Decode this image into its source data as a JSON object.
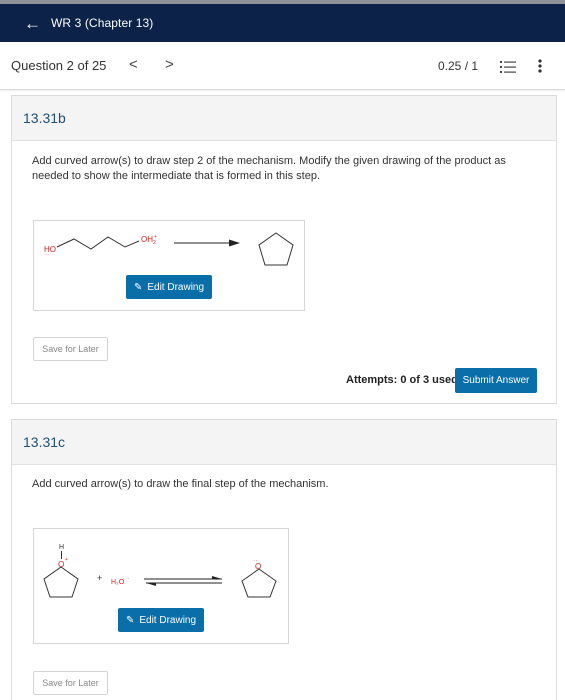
{
  "header": {
    "title": "WR 3 (Chapter 13)",
    "back_icon": "arrow-left-icon"
  },
  "question_bar": {
    "count": "Question 2 of 25",
    "prev": "<",
    "next": ">",
    "score": "0.25 / 1"
  },
  "q1": {
    "id": "13.31b",
    "prompt": "Add curved arrow(s) to draw step 2 of the mechanism. Modify the given drawing of the product as needed to show the intermediate that is formed in this step.",
    "labels": {
      "ho": "HO",
      "oh2": "OH"
    },
    "edit_label": "Edit Drawing",
    "save_label": "Save for Later",
    "attempts": "Attempts: 0 of 3 used",
    "submit_label": "Submit Answer"
  },
  "q2": {
    "id": "13.31c",
    "prompt": "Add curved arrow(s) to draw the final step of the mechanism.",
    "labels": {
      "h": "H",
      "o": "O",
      "plus": "+",
      "h2o": "H₂O",
      "o_ring": "O"
    },
    "edit_label": "Edit Drawing",
    "save_label": "Save for Later"
  },
  "colors": {
    "header_bg": "#0c2248",
    "button_bg": "#0a6ea8",
    "oxygen_red": "#d62020",
    "title_blue": "#1f4f7a"
  }
}
